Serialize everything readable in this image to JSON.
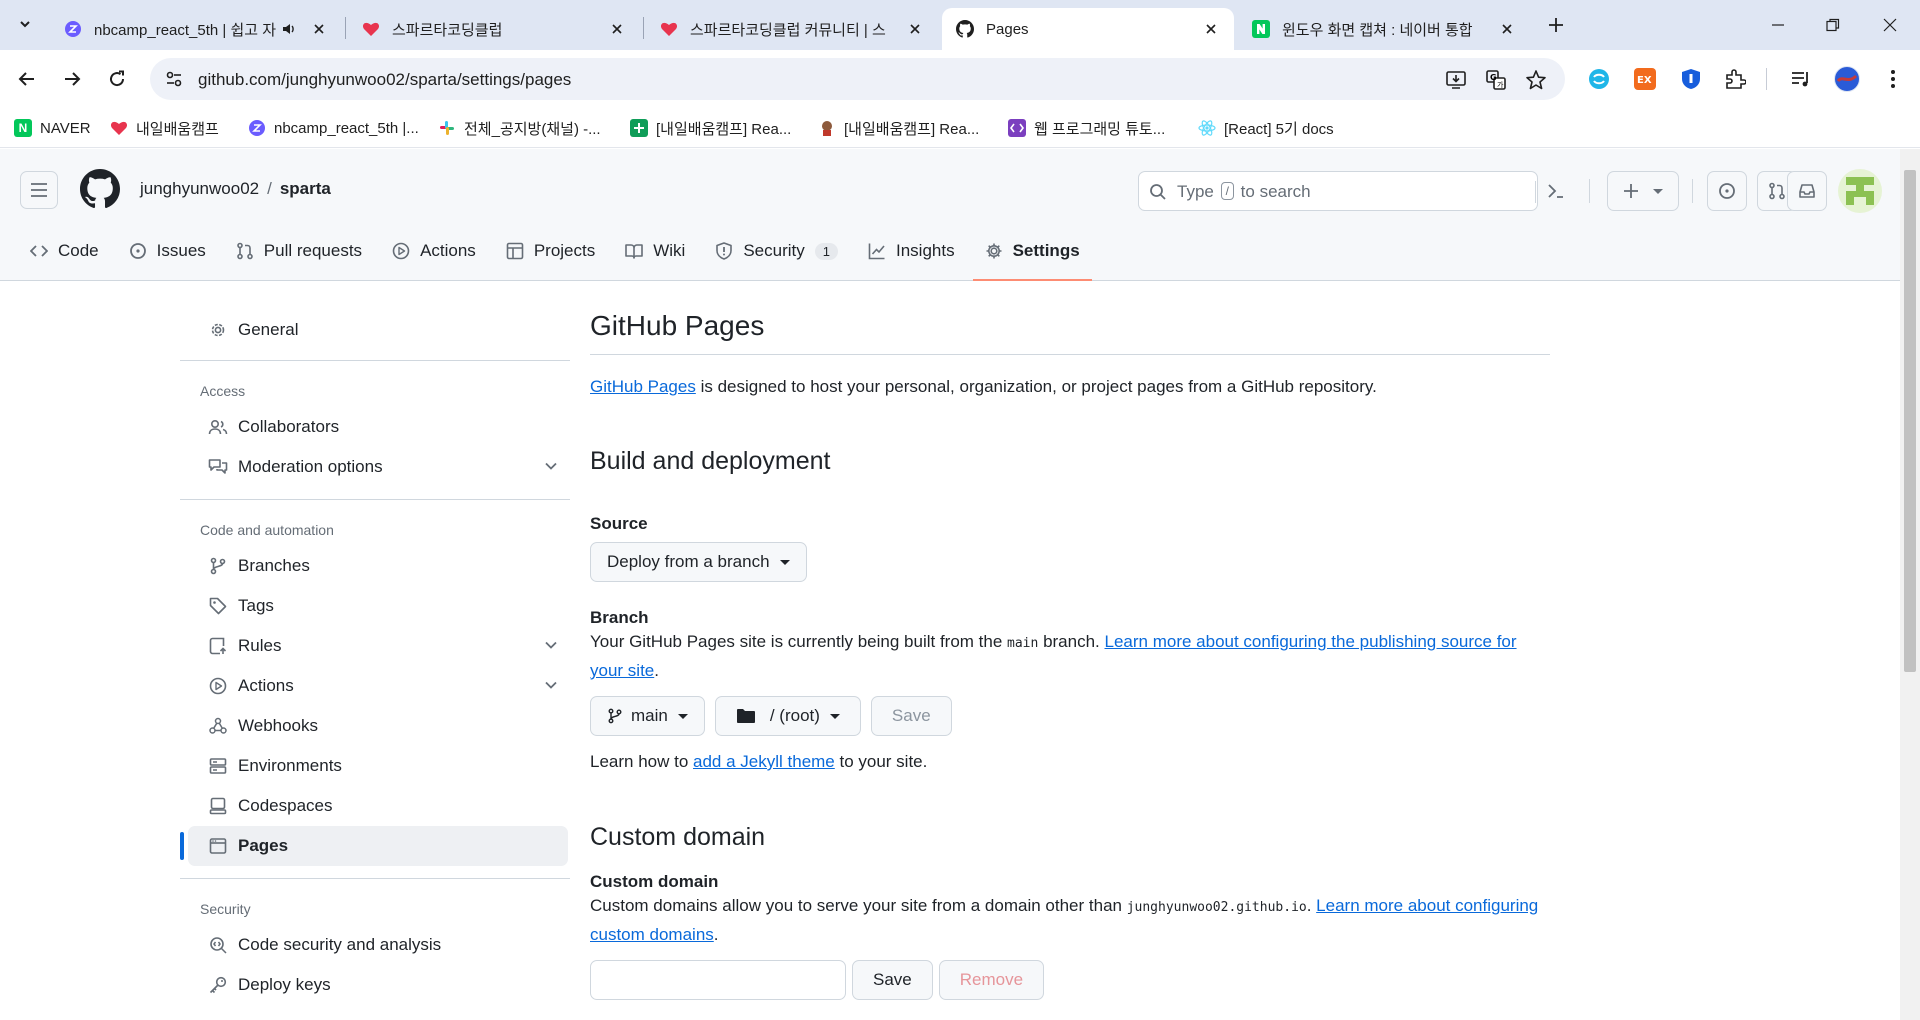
{
  "browser": {
    "tabs": [
      {
        "title": "nbcamp_react_5th | 쉽고 자",
        "icon": "zep-icon",
        "active": false
      },
      {
        "title": "스파르타코딩클럽",
        "icon": "sparta-heart-icon",
        "active": false
      },
      {
        "title": "스파르타코딩클럽 커뮤니티 | 스",
        "icon": "sparta-heart-icon",
        "active": false
      },
      {
        "title": "Pages",
        "icon": "github-icon",
        "active": true
      },
      {
        "title": "윈도우 화면 캡쳐 : 네이버 통합",
        "icon": "naver-icon",
        "active": false
      }
    ],
    "url": "github.com/junghyunwoo02/sparta/settings/pages",
    "bookmarks": [
      {
        "label": "NAVER",
        "icon": "naver-icon",
        "color": "#03c75a"
      },
      {
        "label": "내일배움캠프",
        "icon": "sparta-heart-icon",
        "color": "#e8344e"
      },
      {
        "label": "nbcamp_react_5th |...",
        "icon": "zep-icon",
        "color": "#6b5cff"
      },
      {
        "label": "전체_공지방(채널) -...",
        "icon": "slack-icon",
        "color": "#e01e5a"
      },
      {
        "label": "[내일배움캠프] Rea...",
        "icon": "google-sheets-icon",
        "color": "#0f9d58"
      },
      {
        "label": "[내일배움캠프] Rea...",
        "icon": "character-icon",
        "color": "#8d5a3c"
      },
      {
        "label": "웹 프로그래밍 튜토...",
        "icon": "code-icon",
        "color": "#7b3fbf"
      },
      {
        "label": "[React] 5기 docs",
        "icon": "react-icon",
        "color": "#61dafb"
      }
    ]
  },
  "github": {
    "owner": "junghyunwoo02",
    "repo": "sparta",
    "search": {
      "before": "Type",
      "key": "/",
      "after": "to search"
    },
    "repo_nav": [
      {
        "label": "Code",
        "icon": "code-icon"
      },
      {
        "label": "Issues",
        "icon": "issue-icon"
      },
      {
        "label": "Pull requests",
        "icon": "pull-request-icon"
      },
      {
        "label": "Actions",
        "icon": "play-icon"
      },
      {
        "label": "Projects",
        "icon": "table-icon"
      },
      {
        "label": "Wiki",
        "icon": "book-icon"
      },
      {
        "label": "Security",
        "icon": "shield-icon",
        "count": "1"
      },
      {
        "label": "Insights",
        "icon": "graph-icon"
      },
      {
        "label": "Settings",
        "icon": "gear-icon",
        "active": true
      }
    ]
  },
  "sidebar": {
    "general": "General",
    "access_heading": "Access",
    "access": [
      {
        "label": "Collaborators",
        "icon": "people-icon"
      },
      {
        "label": "Moderation options",
        "icon": "comment-discussion-icon",
        "expandable": true
      }
    ],
    "code_heading": "Code and automation",
    "code": [
      {
        "label": "Branches",
        "icon": "git-branch-icon"
      },
      {
        "label": "Tags",
        "icon": "tag-icon"
      },
      {
        "label": "Rules",
        "icon": "repo-push-icon",
        "expandable": true
      },
      {
        "label": "Actions",
        "icon": "play-icon",
        "expandable": true
      },
      {
        "label": "Webhooks",
        "icon": "webhook-icon"
      },
      {
        "label": "Environments",
        "icon": "server-icon"
      },
      {
        "label": "Codespaces",
        "icon": "codespaces-icon"
      },
      {
        "label": "Pages",
        "icon": "browser-icon",
        "active": true
      }
    ],
    "security_heading": "Security",
    "security": [
      {
        "label": "Code security and analysis",
        "icon": "codescan-icon"
      },
      {
        "label": "Deploy keys",
        "icon": "key-icon"
      }
    ]
  },
  "main": {
    "title": "GitHub Pages",
    "intro_link": "GitHub Pages",
    "intro_text": " is designed to host your personal, organization, or project pages from a GitHub repository.",
    "build_heading": "Build and deployment",
    "source_label": "Source",
    "source_value": "Deploy from a branch",
    "branch_label": "Branch",
    "branch_desc_before": "Your GitHub Pages site is currently being built from the ",
    "branch_desc_code": "main",
    "branch_desc_after": " branch. ",
    "branch_desc_link": "Learn more about configuring the publishing source for your site",
    "branch_desc_end": ".",
    "branch_button": "main",
    "folder_button": "/ (root)",
    "save_label": "Save",
    "jekyll_before": "Learn how to ",
    "jekyll_link": "add a Jekyll theme",
    "jekyll_after": " to your site.",
    "custom_domain_heading": "Custom domain",
    "custom_domain_label": "Custom domain",
    "custom_domain_desc_before": "Custom domains allow you to serve your site from a domain other than ",
    "custom_domain_code": "junghyunwoo02.github.io",
    "custom_domain_desc_mid": ". ",
    "custom_domain_link": "Learn more about configuring custom domains",
    "custom_domain_end": ".",
    "domain_input_value": "",
    "domain_save_label": "Save",
    "domain_remove_label": "Remove"
  },
  "colors": {
    "accent": "#0969da",
    "active_tab_underline": "#fd8c73",
    "chrome_tabstrip": "#dfe6f3"
  }
}
